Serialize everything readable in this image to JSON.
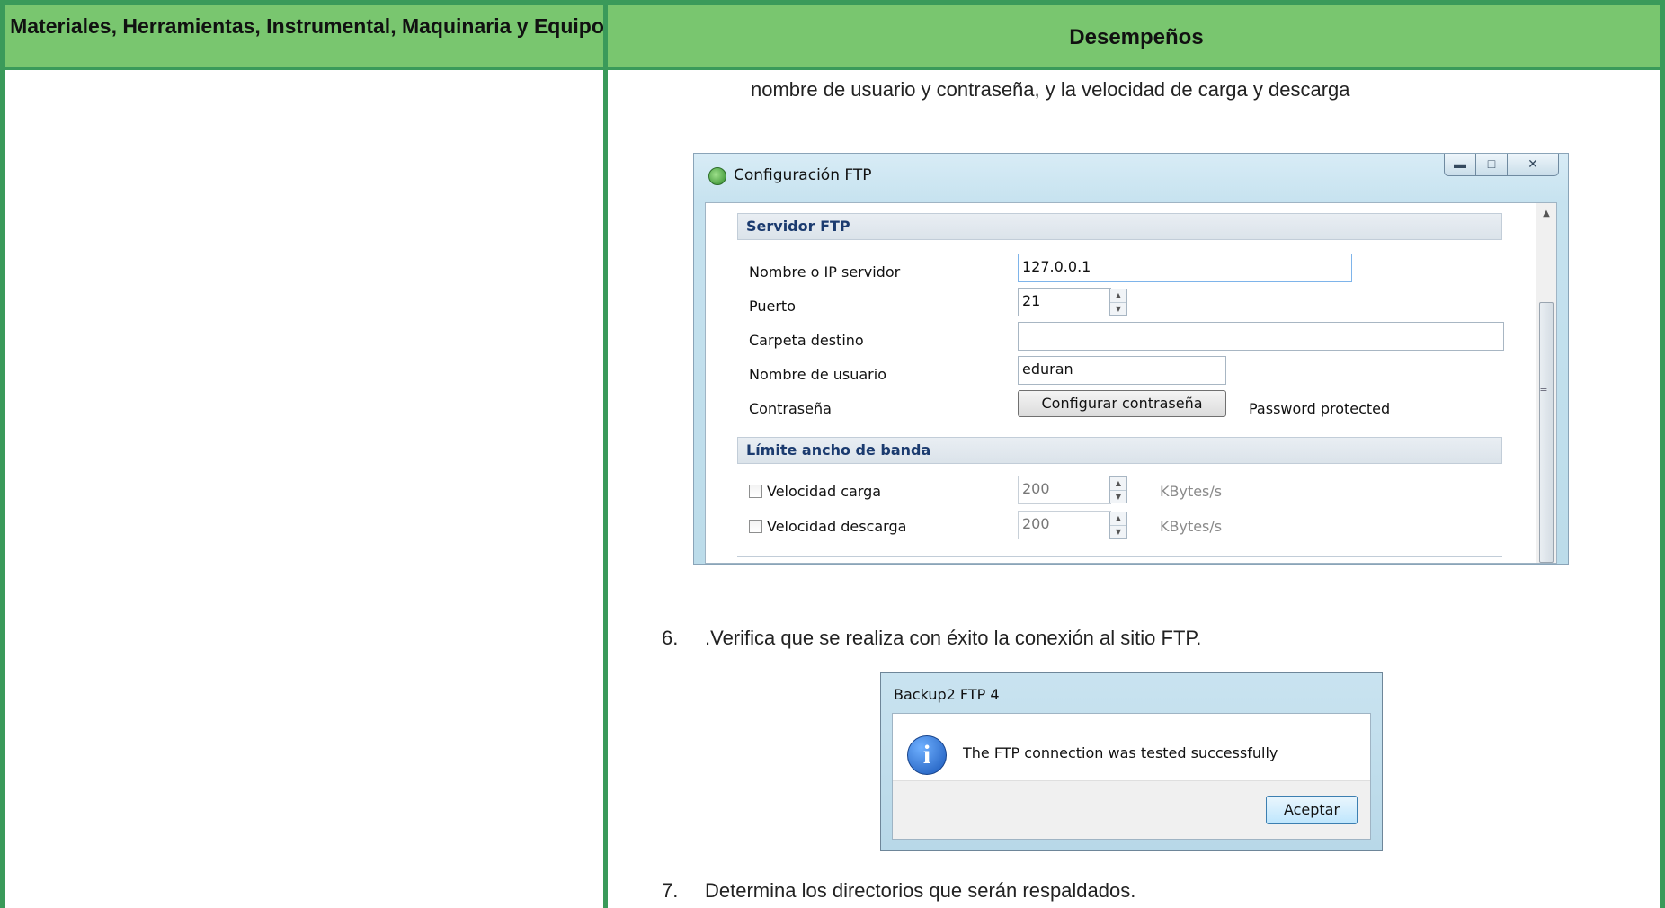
{
  "table": {
    "header_left": "Materiales, Herramientas, Instrumental, Maquinaria y Equipo",
    "header_right": "Desempeños"
  },
  "body": {
    "intro_text": "nombre de usuario y contraseña, y la velocidad de carga y descarga",
    "step6_num": "6.",
    "step6_text": ".Verifica que se  realiza con éxito la conexión al sitio FTP.",
    "step7_num": "7.",
    "step7_text": "Determina los directorios que serán respaldados."
  },
  "ftp_window": {
    "title": "Configuración FTP",
    "section_server": "Servidor FTP",
    "server_label": "Nombre o IP servidor",
    "server_value": "127.0.0.1",
    "port_label": "Puerto",
    "port_value": "21",
    "folder_label": "Carpeta destino",
    "folder_value": "",
    "user_label": "Nombre de usuario",
    "user_value": "eduran",
    "password_label": "Contraseña",
    "password_button": "Configurar contraseña",
    "password_status": "Password protected",
    "section_bandwidth": "Límite ancho de banda",
    "upload_label": "Velocidad carga",
    "upload_value": "200",
    "upload_unit": "KBytes/s",
    "download_label": "Velocidad descarga",
    "download_value": "200",
    "download_unit": "KBytes/s",
    "upload_checked": false,
    "download_checked": false
  },
  "message_box": {
    "title": "Backup2 FTP 4",
    "text": "The FTP connection was tested successfully",
    "ok_button": "Aceptar"
  },
  "colors": {
    "border_green": "#3a9a5a",
    "header_green": "#79c66f"
  }
}
